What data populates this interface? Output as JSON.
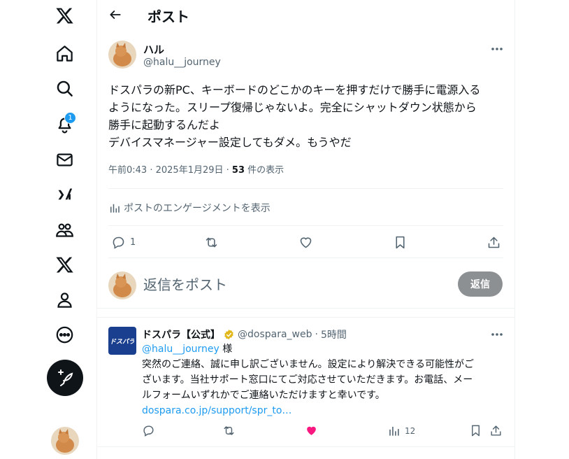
{
  "header": {
    "title": "ポスト"
  },
  "notifications": {
    "badge_count": "1"
  },
  "post": {
    "author_name": "ハル",
    "author_handle": "@halu__journey",
    "text_lines": [
      "ドスパラの新PC、キーボードのどこかのキーを押すだけで勝手に電源入る",
      "ようになった。スリープ復帰じゃないよ。完全にシャットダウン状態から",
      "勝手に起動するんだよ",
      "デバイスマネージャー設定してもダメ。もうやだ"
    ],
    "time": "午前0:43",
    "date": "2025年1月29日",
    "views_count": "53",
    "views_label": "件の表示",
    "engagement_link": "ポストのエンゲージメントを表示",
    "reply_count": "1"
  },
  "composer": {
    "placeholder": "返信をポスト",
    "reply_button": "返信"
  },
  "reply": {
    "author_name": "ドスパラ【公式】",
    "author_handle": "@dospara_web",
    "time": "5時間",
    "mention": "@halu__journey",
    "honorific": " 様",
    "text_lines": [
      "突然のご連絡、誠に申し訳ございません。設定により解決できる可能性がご",
      "ざいます。当社サポート窓口にてご対応させていただきます。お電話、メー",
      "ルフォームいずれかでご連絡いただけますと幸いです。"
    ],
    "link": "dospara.co.jp/support/spr_to…",
    "views_count": "12",
    "avatar_text": "ドスパラ"
  },
  "colors": {
    "accent": "#1d9bf0",
    "like_active": "#f91880",
    "text_primary": "#0f1419",
    "text_secondary": "#536471",
    "reply_button_bg": "#8c9093"
  }
}
